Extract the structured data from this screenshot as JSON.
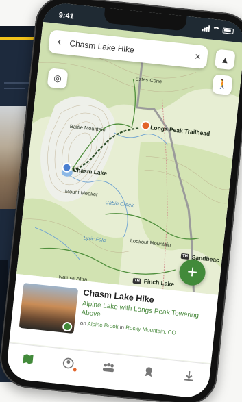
{
  "status_bar": {
    "time": "9:41"
  },
  "search": {
    "query": "Chasm Lake Hike"
  },
  "map": {
    "labels": {
      "estes_cone": "Estes Cone",
      "trailhead": "Longs Peak Trailhead",
      "battle_mountain": "Battle Mountain",
      "chasm_lake": "Chasm Lake",
      "mount_meeker": "Mount Meeker",
      "lookout_mountain": "Lookout Mountain",
      "sandbeach": "Sandbeac",
      "lyric_falls": "Lyric Falls",
      "finch_lake": "Finch Lake",
      "natural_attraction": "Natural Attra",
      "cabin_creek": "Cabin Creek"
    },
    "trailhead_sign": "TH"
  },
  "card": {
    "title": "Chasm Lake Hike",
    "subtitle": "Alpine Lake with Longs Peak Towering Above",
    "location_prefix": "on",
    "location_trail": "Alpine Brook",
    "location_mid": "in",
    "location_area": "Rocky Mountain, CO"
  },
  "tabs": [
    "map-tab",
    "profile-tab",
    "community-tab",
    "badges-tab",
    "downloads-tab"
  ],
  "colors": {
    "brand_green": "#428a3a",
    "trail_orange": "#e2642a",
    "lake_blue": "#4a7fd0"
  }
}
